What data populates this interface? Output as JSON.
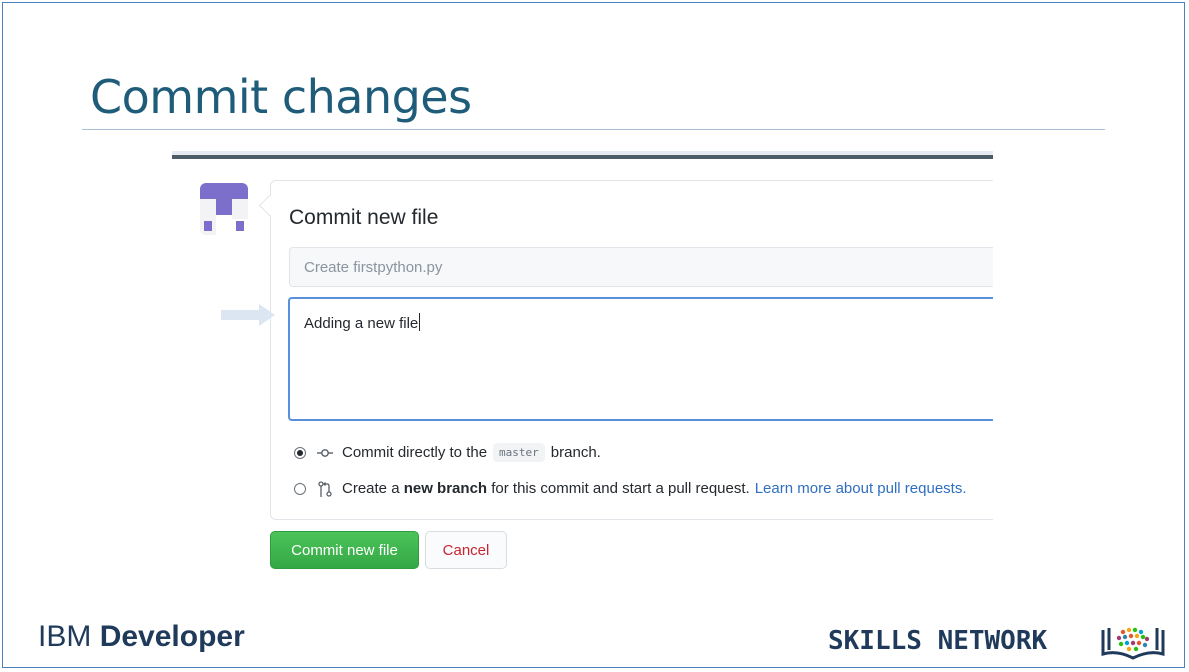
{
  "slide": {
    "title": "Commit changes"
  },
  "commit_form": {
    "heading": "Commit new file",
    "summary_placeholder": "Create firstpython.py",
    "description_value": "Adding a new file",
    "options": {
      "direct": {
        "prefix": "Commit directly to the",
        "branch": "master",
        "suffix": "branch.",
        "selected": true
      },
      "new_branch": {
        "prefix": "Create a",
        "bold": "new branch",
        "suffix": "for this commit and start a pull request.",
        "link": "Learn more about pull requests.",
        "selected": false
      }
    },
    "commit_button_label": "Commit new file",
    "cancel_button_label": "Cancel"
  },
  "footer": {
    "ibm_brand": "IBM",
    "ibm_product": "Developer",
    "skills_network": "SKILLS NETWORK"
  },
  "colors": {
    "title": "#1f5c7a",
    "commit_button": "#3fb950",
    "cancel_text": "#cb2431",
    "link": "#2f6fc0",
    "focus_border": "#5a8fdc",
    "avatar": "#7b6fcb"
  }
}
